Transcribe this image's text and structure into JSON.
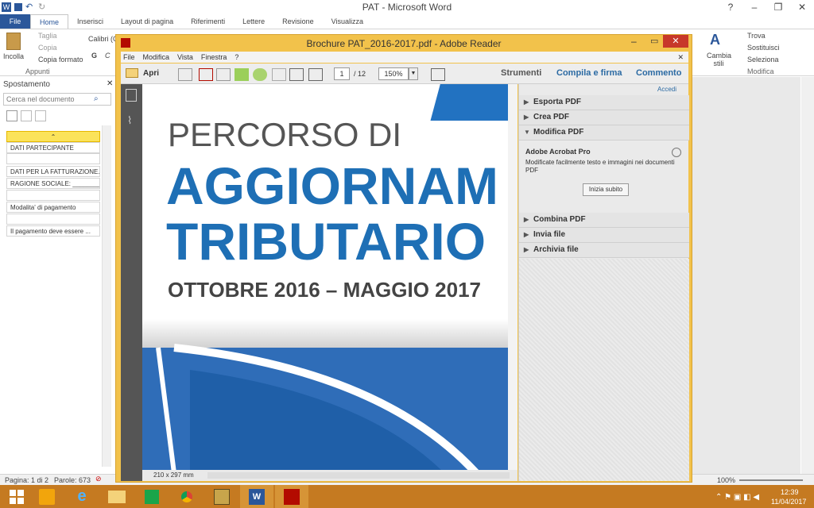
{
  "word": {
    "title": "PAT  -  Microsoft Word",
    "tabs": [
      "File",
      "Home",
      "Inserisci",
      "Layout di pagina",
      "Riferimenti",
      "Lettere",
      "Revisione",
      "Visualizza"
    ],
    "ribbon": {
      "paste": "Incolla",
      "cut": "Taglia",
      "copy": "Copia",
      "format_painter": "Copia formato",
      "clipboard_group": "Appunti",
      "font_name": "Calibri (C",
      "bold": "G",
      "italic": "C",
      "change_styles": "Cambia stili",
      "find": "Trova",
      "replace": "Sostituisci",
      "select": "Seleziona",
      "edit_group": "Modifica"
    },
    "nav": {
      "title": "Spostamento",
      "search_placeholder": "Cerca nel documento",
      "items": [
        "DATI PARTECIPANTE",
        "DATI PER LA FATTURAZIONE...",
        "RAGIONE SOCIALE: ________...",
        "Modalita' di pagamento",
        "Il pagamento deve essere ..."
      ]
    },
    "status": {
      "page": "Pagina: 1 di 2",
      "words": "Parole: 673",
      "zoom": "100%"
    }
  },
  "reader": {
    "title": "Brochure PAT_2016-2017.pdf - Adobe Reader",
    "menu": [
      "File",
      "Modifica",
      "Vista",
      "Finestra",
      "?"
    ],
    "open": "Apri",
    "page_current": "1",
    "page_total": "/ 12",
    "zoom": "150%",
    "tools": "Strumenti",
    "fill_sign": "Compila e firma",
    "comment": "Commento",
    "page_size": "210 x 297 mm",
    "pdf": {
      "line1": "PERCORSO DI",
      "line2": "AGGIORNAM",
      "line3": "TRIBUTARIO",
      "line4": "OTTOBRE 2016 – MAGGIO 2017"
    },
    "panel": {
      "accedi": "Accedi",
      "sections_top": [
        "Esporta PDF",
        "Crea PDF",
        "Modifica PDF"
      ],
      "acrobat_title": "Adobe Acrobat Pro",
      "acrobat_desc": "Modificate facilmente testo e immagini nei documenti PDF",
      "start_btn": "Inizia subito",
      "sections_bottom": [
        "Combina PDF",
        "Invia file",
        "Archivia file"
      ]
    }
  },
  "taskbar": {
    "time": "12:39",
    "date": "11/04/2017"
  }
}
